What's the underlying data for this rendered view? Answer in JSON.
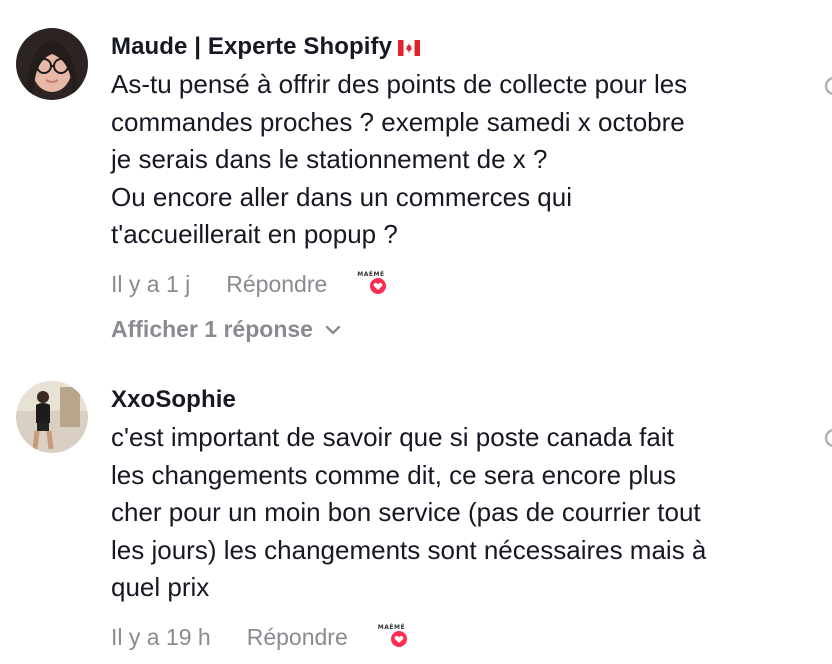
{
  "comments": [
    {
      "username": "Maude | Experte Shopify",
      "text_lines": [
        "As-tu pensé à offrir des points de collecte pour les",
        "commandes proches ? exemple samedi x octobre",
        "je serais dans le stationnement de x ?",
        "Ou encore aller dans un commerces qui",
        "t'accueillerait en popup ?"
      ],
      "time": "Il y a 1 j",
      "reply_label": "Répondre",
      "creator_label": "MAÉMÉ",
      "view_replies_label": "Afficher 1 réponse"
    },
    {
      "username": "XxoSophie",
      "text_lines": [
        "c'est important de savoir que si poste canada fait",
        "les changements comme dit, ce sera encore plus",
        "cher pour un moin bon service (pas de courrier tout",
        "les jours) les changements sont nécessaires mais à",
        "quel prix"
      ],
      "time": "Il y a 19 h",
      "reply_label": "Répondre",
      "creator_label": "MAÉMÉ"
    }
  ],
  "icons": {
    "flag": "canada-flag-icon",
    "creator_heart": "heart-icon",
    "chevron": "chevron-down-icon",
    "like": "like-icon"
  },
  "colors": {
    "text": "#161823",
    "secondary": "#8a8b91",
    "heart": "#fe2c55"
  }
}
